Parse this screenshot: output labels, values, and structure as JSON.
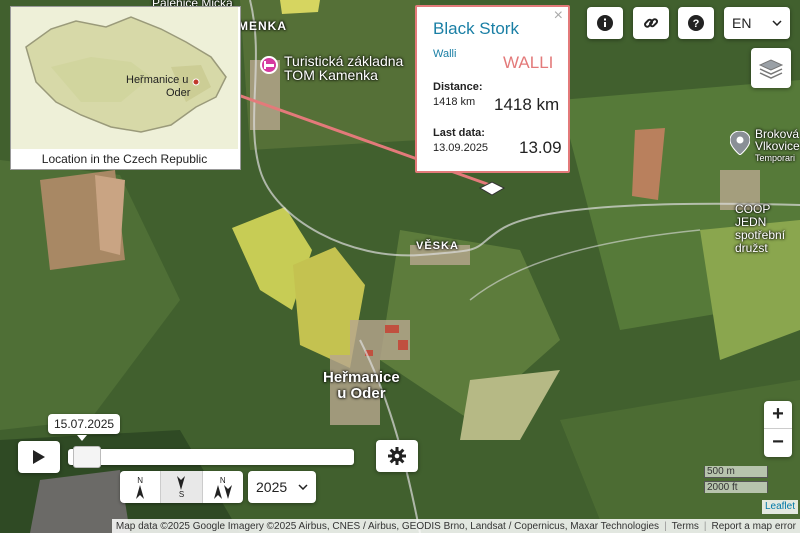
{
  "map_labels": {
    "top_left_place": "Palehice Mička",
    "kamenka": "MENKA",
    "poi_name_line1": "Turistická základna",
    "poi_name_line2": "TOM Kamenka",
    "veska": "VĚSKA",
    "hermanice_line1": "Heřmanice",
    "hermanice_line2": "u Oder",
    "brokova_line1": "Broková",
    "brokova_line2": "Vlkovice",
    "brokova_line3": "Temporari",
    "coop_line1": "COOP JEDN",
    "coop_line2": "spotřební družst"
  },
  "inset": {
    "place_line1": "Heřmanice u",
    "place_line2": "Oder",
    "caption": "Location in the Czech Republic"
  },
  "popup": {
    "title": "Black Stork",
    "subtitle": "Walli",
    "name_big": "WALLI",
    "close": "×",
    "distance_label": "Distance:",
    "distance_small": "1418 km",
    "distance_big": "1418 km",
    "last_data_label": "Last data:",
    "last_data_small": "13.09.2025",
    "last_data_big": "13.09"
  },
  "toolbar": {
    "info_icon": "info-icon",
    "link_icon": "link-icon",
    "help_icon": "help-icon",
    "language": "EN",
    "layers_icon": "layers-icon"
  },
  "timeline": {
    "date_tooltip": "15.07.2025",
    "progress": 0.02,
    "year": "2025",
    "play_icon": "play-icon",
    "settings_icon": "gear-icon",
    "direction_buttons": [
      "N",
      "S",
      "N"
    ]
  },
  "zoom": {
    "in": "+",
    "out": "−"
  },
  "scale": {
    "metric": "500 m",
    "imperial": "2000 ft"
  },
  "attribution": {
    "leaflet": "Leaflet",
    "map_data": "Map data ©2025 Google Imagery ©2025 Airbus, CNES / Airbus, GEODIS Brno, Landsat / Copernicus, Maxar Technologies",
    "terms": "Terms",
    "report": "Report a map error"
  },
  "colors": {
    "accent": "#1a7fa5",
    "track": "#e37a7a",
    "poi": "#d63aa0"
  }
}
